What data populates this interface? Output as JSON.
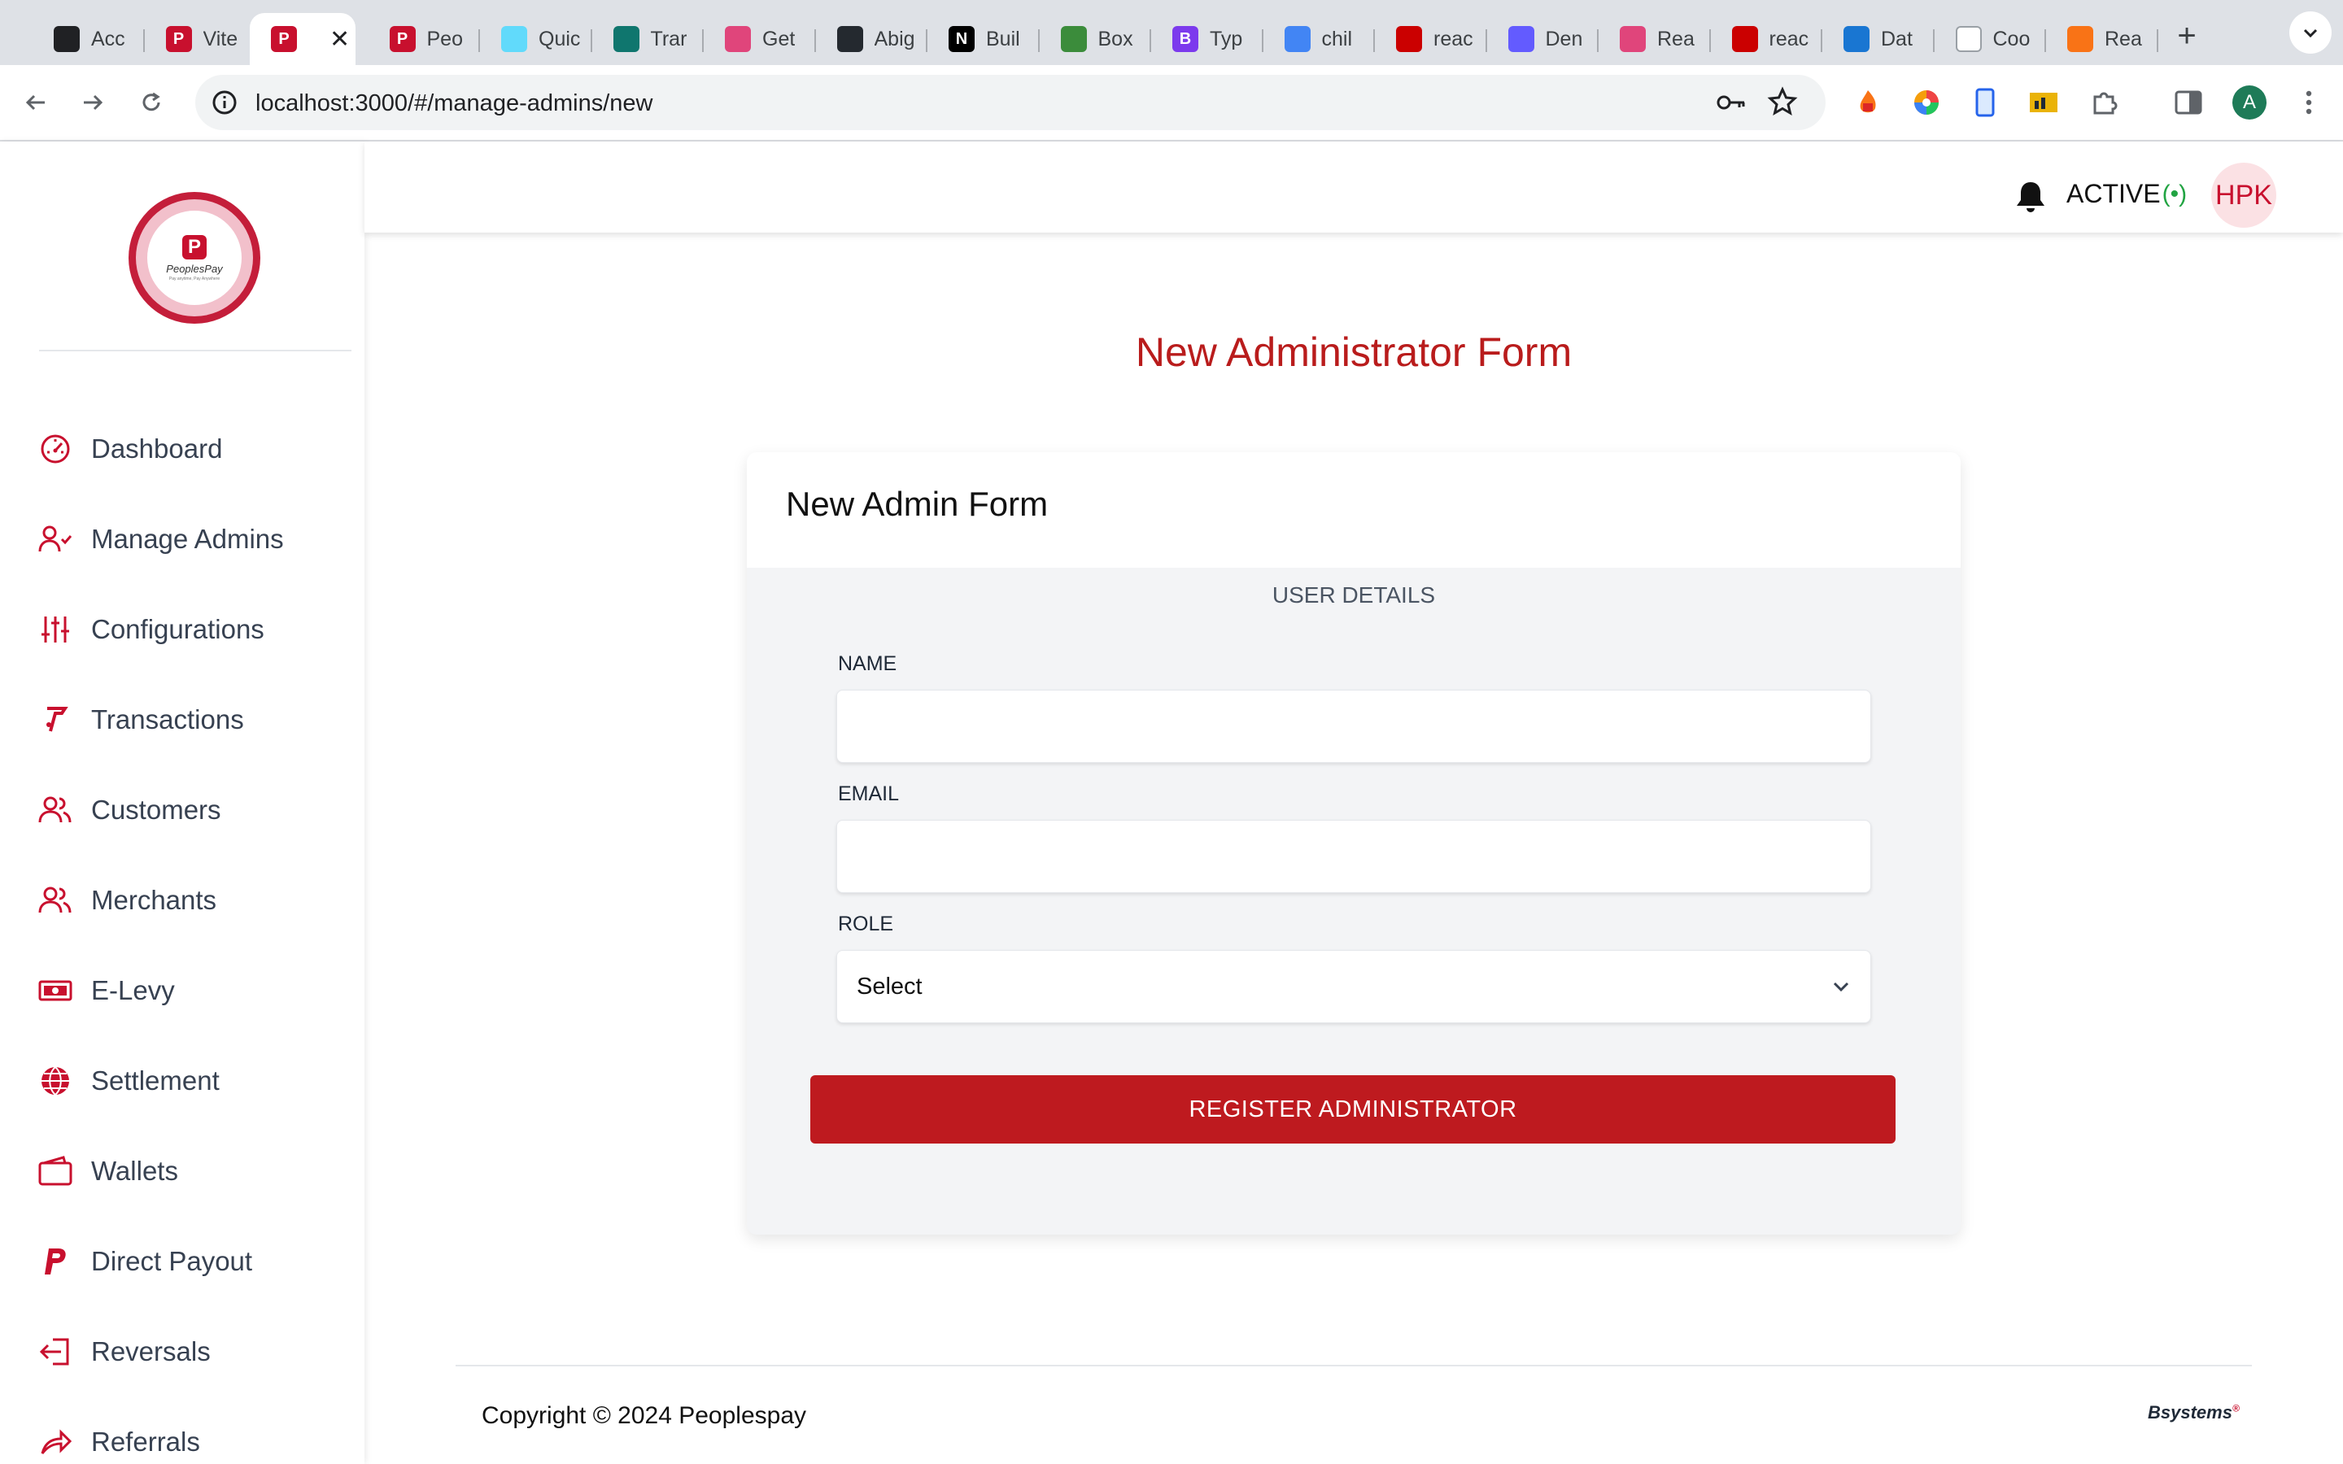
{
  "browser": {
    "tabs": [
      {
        "title": "Acc",
        "icon": "openai-icon",
        "color": "#202124"
      },
      {
        "title": "Vite",
        "icon": "peoplespay-icon",
        "color": "#c8102e"
      },
      {
        "title": "",
        "icon": "peoplespay-icon",
        "color": "#c8102e",
        "active": true
      },
      {
        "title": "Peo",
        "icon": "peoplespay-icon",
        "color": "#c8102e"
      },
      {
        "title": "Quic",
        "icon": "react-icon",
        "color": "#61dafb"
      },
      {
        "title": "Trar",
        "icon": "tailwind-icon",
        "color": "#0f766e"
      },
      {
        "title": "Get",
        "icon": "pink-square-icon",
        "color": "#e0457b"
      },
      {
        "title": "Abig",
        "icon": "github-icon",
        "color": "#24292f"
      },
      {
        "title": "Buil",
        "icon": "nextjs-icon",
        "color": "#000000"
      },
      {
        "title": "Box",
        "icon": "green-box-icon",
        "color": "#3b8c3b"
      },
      {
        "title": "Typ",
        "icon": "bootstrap-icon",
        "color": "#7c3aed"
      },
      {
        "title": "chil",
        "icon": "google-icon",
        "color": "#4285f4"
      },
      {
        "title": "reac",
        "icon": "npm-icon",
        "color": "#cb0000"
      },
      {
        "title": "Den",
        "icon": "stripe-icon",
        "color": "#635bff"
      },
      {
        "title": "Rea",
        "icon": "react-icon",
        "color": "#e0457b"
      },
      {
        "title": "reac",
        "icon": "npm-icon",
        "color": "#cb0000"
      },
      {
        "title": "Dat",
        "icon": "mui-icon",
        "color": "#1976d2"
      },
      {
        "title": "Coo",
        "icon": "blank-page-icon",
        "color": "#ffffff"
      },
      {
        "title": "Rea",
        "icon": "lines-icon",
        "color": "#f97316"
      }
    ],
    "close_glyph": "✕",
    "new_tab_glyph": "+",
    "url": "localhost:3000/#/manage-admins/new",
    "profile_initial": "A"
  },
  "app": {
    "logo": {
      "brand": "PeoplesPay",
      "mark": "P",
      "tagline": "Pay anytime, Pay Anywhere"
    },
    "sidebar": {
      "items": [
        {
          "label": "Dashboard",
          "icon": "dashboard-gauge-icon"
        },
        {
          "label": "Manage Admins",
          "icon": "user-check-icon"
        },
        {
          "label": "Configurations",
          "icon": "sliders-icon"
        },
        {
          "label": "Transactions",
          "icon": "transactions-icon"
        },
        {
          "label": "Customers",
          "icon": "users-icon"
        },
        {
          "label": "Merchants",
          "icon": "users-icon"
        },
        {
          "label": "E-Levy",
          "icon": "cash-icon"
        },
        {
          "label": "Settlement",
          "icon": "globe-icon"
        },
        {
          "label": "Wallets",
          "icon": "wallet-icon"
        },
        {
          "label": "Direct Payout",
          "icon": "paypal-icon"
        },
        {
          "label": "Reversals",
          "icon": "reversal-icon"
        },
        {
          "label": "Referrals",
          "icon": "share-icon"
        }
      ]
    },
    "topbar": {
      "status": "ACTIVE",
      "signal_glyph": "(•)",
      "avatar": "HPK"
    },
    "page_title": "New Administrator Form",
    "form": {
      "card_title": "New Admin Form",
      "section": "USER DETAILS",
      "name_label": "NAME",
      "name_value": "",
      "email_label": "EMAIL",
      "email_value": "",
      "role_label": "ROLE",
      "role_selected": "Select",
      "submit_label": "REGISTER ADMINISTRATOR"
    },
    "footer": {
      "copyright": "Copyright © 2024 Peoplespay",
      "logo_text": "Bsystems",
      "logo_mark": "®"
    },
    "colors": {
      "brand_red": "#be1a1f",
      "title_red": "#b91c1c",
      "icon_red": "#c8102e",
      "active_green": "#22a443"
    }
  }
}
